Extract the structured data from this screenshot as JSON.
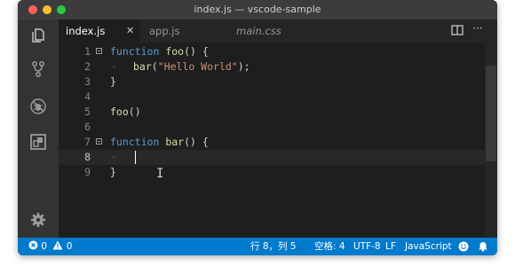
{
  "window": {
    "title": "index.js — vscode-sample"
  },
  "activity_bar": {
    "items": [
      {
        "icon": "files-icon"
      },
      {
        "icon": "source-control-icon"
      },
      {
        "icon": "debug-icon"
      },
      {
        "icon": "extensions-icon"
      },
      {
        "icon": "settings-gear-icon"
      }
    ]
  },
  "tabs": [
    {
      "label": "index.js",
      "active": true,
      "close": "✕"
    },
    {
      "label": "app.js",
      "active": false
    },
    {
      "label": "main.css",
      "active": false,
      "italic": true
    }
  ],
  "editor_actions": {
    "split_icon": "split-editor-icon",
    "more": "···"
  },
  "editor": {
    "current_line": 8,
    "lines": [
      {
        "n": "1",
        "t1": "function ",
        "t2": "foo",
        "t3": "() {"
      },
      {
        "n": "2",
        "t1": "bar",
        "t2": "(",
        "t3": "\"Hello World\"",
        "t4": ");"
      },
      {
        "n": "3",
        "t1": "}"
      },
      {
        "n": "4"
      },
      {
        "n": "5",
        "t1": "foo",
        "t2": "()"
      },
      {
        "n": "6"
      },
      {
        "n": "7",
        "t1": "function ",
        "t2": "bar",
        "t3": "() {"
      },
      {
        "n": "8"
      },
      {
        "n": "9",
        "t1": "}"
      }
    ],
    "whitespace_marker": "⇥"
  },
  "status_bar": {
    "errors": "0",
    "warnings": "0",
    "position": "行 8，列 5",
    "spaces": "空格: 4",
    "encoding": "UTF-8",
    "eol": "LF",
    "language": "JavaScript",
    "feedback_icon": "smiley-icon",
    "notifications_icon": "bell-icon"
  },
  "colors": {
    "status_bar": "#007acc",
    "keyword": "#569cd6",
    "function": "#dcdcaa",
    "string": "#ce9178"
  }
}
